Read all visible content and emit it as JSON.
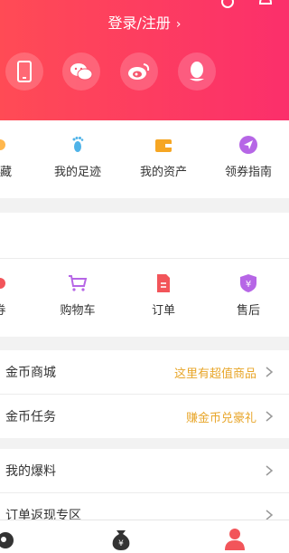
{
  "header": {
    "login_text": "登录/注册",
    "arrow": "›",
    "social": [
      "phone-icon",
      "wechat-icon",
      "weibo-icon",
      "qq-icon"
    ],
    "gradient": [
      "#ff4b55",
      "#fb2f6b"
    ]
  },
  "quick_menu": [
    {
      "label": "收藏",
      "icon": "star-icon"
    },
    {
      "label": "我的足迹",
      "icon": "footprint-icon"
    },
    {
      "label": "我的资产",
      "icon": "wallet-icon"
    },
    {
      "label": "领券指南",
      "icon": "send-icon"
    }
  ],
  "order_menu": [
    {
      "label": "券",
      "icon": "coupon-icon"
    },
    {
      "label": "购物车",
      "icon": "cart-icon"
    },
    {
      "label": "订单",
      "icon": "order-icon"
    },
    {
      "label": "售后",
      "icon": "after-sale-icon"
    }
  ],
  "list_rows": [
    {
      "left": "金币商城",
      "right": "这里有超值商品"
    },
    {
      "left": "金币任务",
      "right": "赚金币兑豪礼"
    },
    {
      "left": "我的爆料",
      "right": ""
    },
    {
      "left": "订单返现专区",
      "right": ""
    }
  ],
  "colors": {
    "accent": "#e8a62a",
    "brand": "#fb2f6b"
  }
}
